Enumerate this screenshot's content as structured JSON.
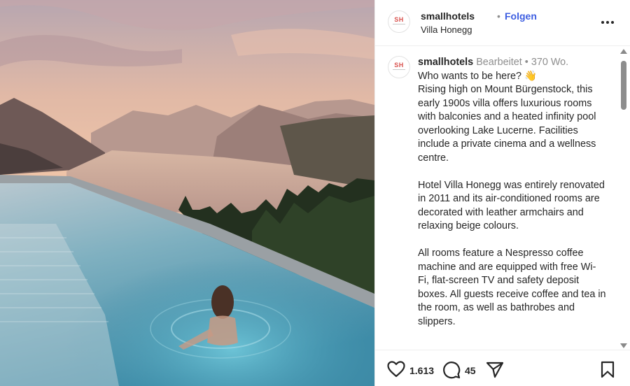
{
  "post": {
    "username": "smallhotels",
    "separator": "•",
    "follow_label": "Folgen",
    "location": "Villa Honegg",
    "avatar_initials": "SH"
  },
  "caption": {
    "username": "smallhotels",
    "edited_label": "Bearbeitet",
    "separator": "•",
    "time_ago": "370 Wo.",
    "line1": "Who wants to be here? 👋",
    "paragraph1": "Rising high on Mount Bürgenstock, this early 1900s villa offers luxurious rooms with balconies and a heated infinity pool overlooking Lake Lucerne. Facilities include a private cinema and a wellness centre.",
    "paragraph2": "Hotel Villa Honegg was entirely renovated in 2011 and its air-conditioned rooms are decorated with leather armchairs and relaxing beige colours.",
    "paragraph3": "All rooms feature a Nespresso coffee machine and are equipped with free Wi-Fi, flat-screen TV and safety deposit boxes. All guests receive coffee and tea in the room, as well as bathrobes and slippers."
  },
  "actions": {
    "likes": "1.613",
    "comments": "45"
  },
  "icons": {
    "like": "heart-icon",
    "comment": "comment-icon",
    "share": "share-icon",
    "save": "bookmark-icon",
    "more": "more-options-icon"
  }
}
